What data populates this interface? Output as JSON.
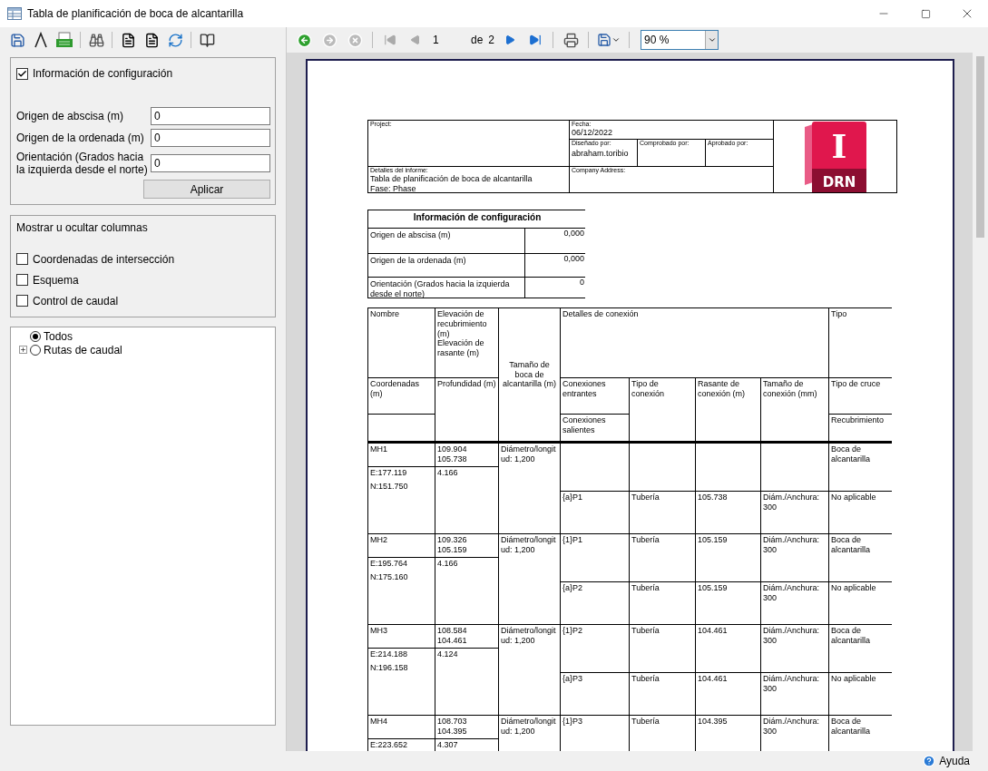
{
  "window": {
    "title": "Tabla de planificación de boca de alcantarilla"
  },
  "left_panel": {
    "config": {
      "label": "Información de configuración",
      "checked": true,
      "fields": [
        {
          "label": "Origen de abscisa (m)",
          "value": "0"
        },
        {
          "label": "Origen de la ordenada (m)",
          "value": "0"
        },
        {
          "label": "Orientación (Grados hacia la izquierda desde el norte)",
          "value": "0"
        }
      ],
      "apply_button": "Aplicar"
    },
    "columns_box": {
      "title": "Mostrar u ocultar columnas",
      "options": [
        {
          "label": "Coordenadas de intersección",
          "checked": false
        },
        {
          "label": "Esquema",
          "checked": false
        },
        {
          "label": "Control de caudal",
          "checked": false
        }
      ]
    },
    "tree": [
      {
        "label": "Todos",
        "selected": true
      },
      {
        "label": "Rutas de caudal",
        "selected": false,
        "expanded": false
      }
    ]
  },
  "viewer_toolbar": {
    "page": "1",
    "of_label": "de",
    "total": "2",
    "zoom": "90 %"
  },
  "report": {
    "header": {
      "project_label": "Project:",
      "date_label": "Fecha:",
      "date": "06/12/2022",
      "designed_label": "Diseñado por:",
      "designed_by": "abraham.toribio",
      "checked_label": "Comprobado por:",
      "approved_label": "Aprobado por:",
      "details_label": "Detalles del informe:",
      "details": "Tabla de planificación de boca de alcantarilla",
      "phase": "Fase: Phase",
      "company_label": "Company Address:",
      "logo": {
        "letter": "I",
        "label": "DRN"
      }
    },
    "config_table": {
      "title": "Información de configuración",
      "rows": [
        {
          "label": "Origen de abscisa (m)",
          "value": "0,000"
        },
        {
          "label": "Origen de la ordenada (m)",
          "value": "0,000"
        },
        {
          "label": "Orientación (Grados hacia la izquierda desde el norte)",
          "value": "0"
        }
      ]
    },
    "table": {
      "headers": {
        "name": "Nombre",
        "cover_elevation": "Elevación de recubrimiento (m)",
        "invert_elevation": "Elevación de rasante (m)",
        "size": "Tamaño de boca de alcantarilla (m)",
        "details": "Detalles de conexión",
        "type": "Tipo",
        "coordinates": "Coordenadas (m)",
        "depth": "Profundidad (m)",
        "incoming": "Conexiones entrantes",
        "outgoing": "Conexiones salientes",
        "connection_type": "Tipo de conexión",
        "connection_invert": "Rasante de conexión (m)",
        "connection_size": "Tamaño de conexión (mm)",
        "crossing": "Tipo de cruce",
        "cover": "Recubrimiento"
      },
      "manholes": [
        {
          "name": "MH1",
          "cover_elevation": "109.904",
          "invert_elevation": "105.738",
          "coordinates": [
            "E:177.119",
            "N:151.750"
          ],
          "depth": "4.166",
          "size": "Diámetro/longitud: 1,200",
          "connections": [
            {
              "type_label": "Boca de alcantarilla"
            },
            {
              "connection": "{a}P1",
              "connection_type": "Tubería",
              "invert": "105.738",
              "size": "Diám./Anchura: 300",
              "type_label": "No aplicable"
            }
          ]
        },
        {
          "name": "MH2",
          "cover_elevation": "109.326",
          "invert_elevation": "105.159",
          "coordinates": [
            "E:195.764",
            "N:175.160"
          ],
          "depth": "4.166",
          "size": "Diámetro/longitud: 1,200",
          "connections": [
            {
              "connection": "{1}P1",
              "connection_type": "Tubería",
              "invert": "105.159",
              "size": "Diám./Anchura: 300",
              "type_label": "Boca de alcantarilla"
            },
            {
              "connection": "{a}P2",
              "connection_type": "Tubería",
              "invert": "105.159",
              "size": "Diám./Anchura: 300",
              "type_label": "No aplicable"
            }
          ]
        },
        {
          "name": "MH3",
          "cover_elevation": "108.584",
          "invert_elevation": "104.461",
          "coordinates": [
            "E:214.188",
            "N:196.158"
          ],
          "depth": "4.124",
          "size": "Diámetro/longitud: 1,200",
          "connections": [
            {
              "connection": "{1}P2",
              "connection_type": "Tubería",
              "invert": "104.461",
              "size": "Diám./Anchura: 300",
              "type_label": "Boca de alcantarilla"
            },
            {
              "connection": "{a}P3",
              "connection_type": "Tubería",
              "invert": "104.461",
              "size": "Diám./Anchura: 300",
              "type_label": "No aplicable"
            }
          ]
        },
        {
          "name": "MH4",
          "cover_elevation": "108.703",
          "invert_elevation": "104.395",
          "coordinates": [
            "E:223.652"
          ],
          "depth": "4.307",
          "size": "Diámetro/longitud: 1,200",
          "connections": [
            {
              "connection": "{1}P3",
              "connection_type": "Tubería",
              "invert": "104.395",
              "size": "Diám./Anchura: 300",
              "type_label": "Boca de alcantarilla"
            }
          ]
        }
      ]
    }
  },
  "status_bar": {
    "help": "Ayuda"
  }
}
